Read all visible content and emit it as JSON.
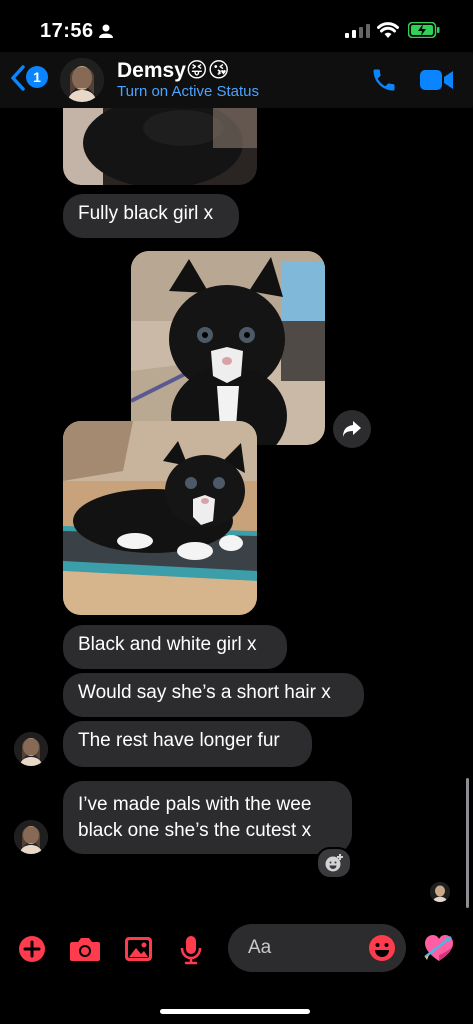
{
  "status_bar": {
    "time": "17:56"
  },
  "header": {
    "unread_count": "1",
    "contact_name": "Demsy😝😘",
    "status_text": "Turn on Active Status"
  },
  "messages": [
    {
      "type": "image",
      "description": "black kitten (cropped)"
    },
    {
      "type": "text",
      "text": "Fully black girl x"
    },
    {
      "type": "image",
      "description": "black and white kitten"
    },
    {
      "type": "image",
      "description": "black and white kitten lying on blanket"
    },
    {
      "type": "text",
      "text": "Black and white girl x"
    },
    {
      "type": "text",
      "text": "Would say she’s a short hair x"
    },
    {
      "type": "text",
      "text": "The rest have longer fur"
    },
    {
      "type": "text",
      "lines": [
        "I’ve made pals with the wee",
        "black one she’s the cutest x"
      ]
    }
  ],
  "composer": {
    "placeholder": "Aa"
  },
  "colors": {
    "accent": "#0a84ff",
    "composer_icons": "#ff3b4e",
    "bubble": "#2c2c2e"
  }
}
